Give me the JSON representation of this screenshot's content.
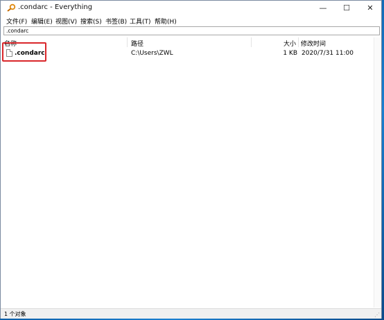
{
  "window": {
    "title": ".condarc - Everything",
    "controls": {
      "minimize": "—",
      "maximize": "☐",
      "close": "✕"
    }
  },
  "menu": [
    {
      "label": "文件(F)"
    },
    {
      "label": "编辑(E)"
    },
    {
      "label": "视图(V)"
    },
    {
      "label": "搜索(S)"
    },
    {
      "label": "书签(B)"
    },
    {
      "label": "工具(T)"
    },
    {
      "label": "帮助(H)"
    }
  ],
  "search": {
    "value": ".condarc"
  },
  "columns": {
    "name": "名称",
    "path": "路径",
    "size": "大小",
    "modified": "修改时间"
  },
  "results": [
    {
      "name": ".condarc",
      "path": "C:\\Users\\ZWL",
      "size": "1 KB",
      "modified": "2020/7/31 11:00"
    }
  ],
  "status": {
    "text": "1 个对象"
  },
  "icons": {
    "app": "magnifier-icon",
    "file": "file-icon"
  },
  "colors": {
    "highlight": "#d9262a",
    "desktop": "#0d5fa8"
  }
}
